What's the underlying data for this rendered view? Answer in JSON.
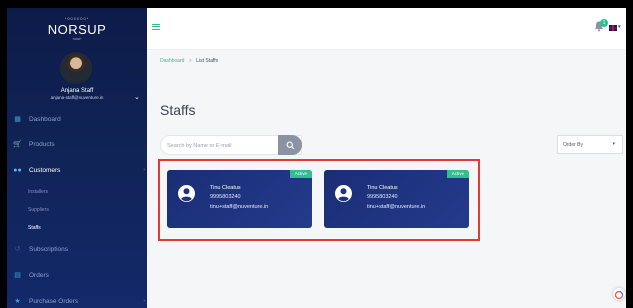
{
  "brand": {
    "tagline": "*000000*",
    "name": "NORSUP",
    "subline": "*0000*"
  },
  "user": {
    "name": "Anjana Staff",
    "email": "anjana-staff@nuventure.in"
  },
  "nav": [
    {
      "label": "Dashboard",
      "icon": "dashboard-icon"
    },
    {
      "label": "Products",
      "icon": "cart-icon"
    },
    {
      "label": "Customers",
      "icon": "users-icon"
    },
    {
      "label": "Subscriptions",
      "icon": "subscriptions-icon"
    },
    {
      "label": "Orders",
      "icon": "orders-icon"
    },
    {
      "label": "Purchase Orders",
      "icon": "purchase-orders-icon"
    }
  ],
  "sub_nav": [
    {
      "label": "Installers"
    },
    {
      "label": "Suppliers"
    },
    {
      "label": "Staffs"
    }
  ],
  "topbar": {
    "notification_count": "1"
  },
  "breadcrumb": {
    "home": "Dashboard",
    "separator": ">",
    "current": "List Staffs"
  },
  "page_title": "Staffs",
  "search": {
    "placeholder": "Search by Name or E-mail",
    "value": ""
  },
  "order_by": {
    "label": "Order By"
  },
  "staff_cards": [
    {
      "status": "Active",
      "name": "Tinu Cleatus",
      "phone": "9995803240",
      "email": "tinu+staff@nuventure.in"
    },
    {
      "status": "Active",
      "name": "Tinu Cleatus",
      "phone": "9995803240",
      "email": "tinu+staff@nuventure.in"
    }
  ],
  "colors": {
    "sidebar": "#13296a",
    "accent": "#2ec08e",
    "card": "#1f3480",
    "highlight": "#e53935"
  }
}
